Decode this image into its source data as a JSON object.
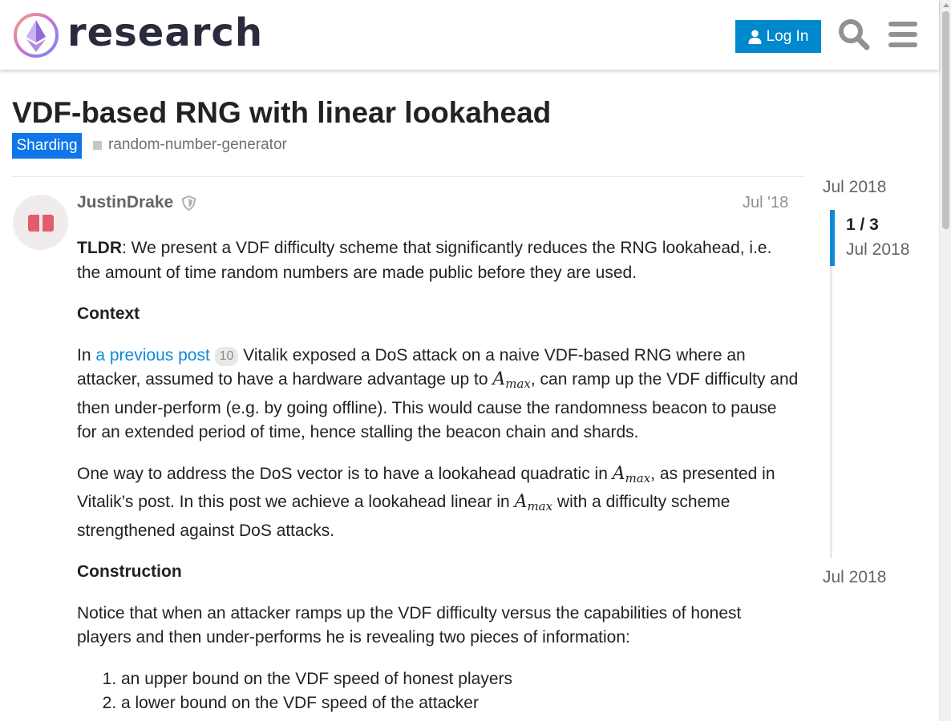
{
  "header": {
    "logo_text": "research",
    "login_label": "Log In"
  },
  "topic": {
    "title": "VDF-based RNG with linear lookahead",
    "category": "Sharding",
    "tag": "random-number-generator"
  },
  "post": {
    "username": "JustinDrake",
    "date": "Jul '18",
    "tldr_label": "TLDR",
    "tldr_text": ": We present a VDF difficulty scheme that significantly reduces the RNG lookahead, i.e. the amount of time random numbers are made public before they are used.",
    "context_heading": "Context",
    "p1_before_link": "In ",
    "p1_link": "a previous post",
    "p1_link_clicks": "10",
    "p1_after_link": " Vitalik exposed a DoS attack on a naive VDF-based RNG where an attacker, assumed to have a hardware advantage up to ",
    "p1_after_math": ", can ramp up the VDF difficulty and then under-perform (e.g. by going offline). This would cause the randomness beacon to pause for an extended period of time, hence stalling the beacon chain and shards.",
    "p2_part1": "One way to address the DoS vector is to have a lookahead quadratic in ",
    "p2_part2": ", as presented in Vitalik’s post. In this post we achieve a lookahead linear in ",
    "p2_part3": " with a difficulty scheme strengthened against DoS attacks.",
    "math_base": "A",
    "math_sub": "max",
    "construction_heading": "Construction",
    "p3": "Notice that when an attacker ramps up the VDF difficulty versus the capabilities of honest players and then under-performs he is revealing two pieces of information:",
    "list": [
      "an upper bound on the VDF speed of honest players",
      "a lower bound on the VDF speed of the attacker"
    ]
  },
  "timeline": {
    "start_date": "Jul 2018",
    "counter": "1 / 3",
    "current_date": "Jul 2018",
    "end_date": "Jul 2018"
  },
  "colors": {
    "accent": "#0088cc",
    "category": "#0e76e8",
    "link": "#0e8ad8"
  }
}
